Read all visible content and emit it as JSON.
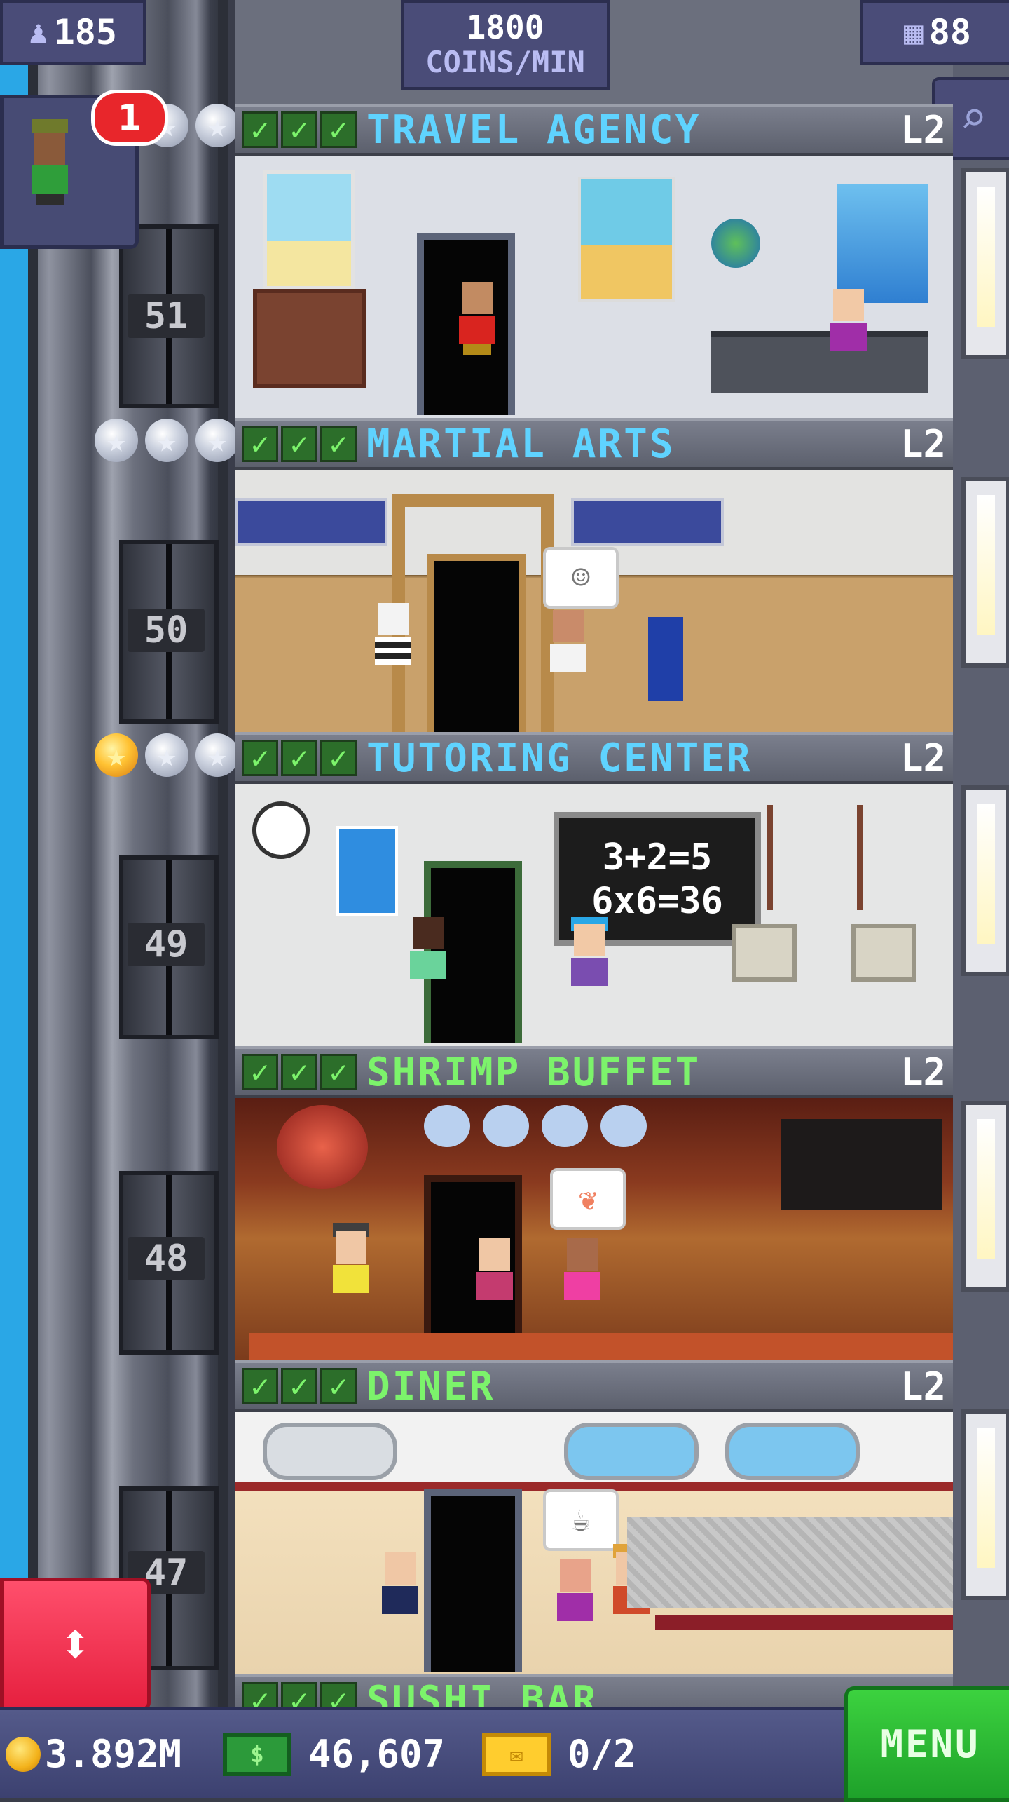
{
  "hud": {
    "population": "185",
    "coins_per_min_value": "1800",
    "coins_per_min_unit": "COINS/MIN",
    "floor_count": "88"
  },
  "notification": {
    "badge_count": "1"
  },
  "floors": [
    {
      "name": "TRAVEL AGENCY",
      "level": "L2",
      "name_color": "#5fd3ff"
    },
    {
      "name": "MARTIAL ARTS",
      "level": "L2",
      "name_color": "#5fd3ff"
    },
    {
      "name": "TUTORING CENTER",
      "level": "L2",
      "name_color": "#5fd3ff"
    },
    {
      "name": "SHRIMP BUFFET",
      "level": "L2",
      "name_color": "#7cf36b"
    },
    {
      "name": "DINER",
      "level": "L2",
      "name_color": "#7cf36b"
    },
    {
      "name": "SUSHI BAR",
      "level": "",
      "name_color": "#7cf36b"
    }
  ],
  "elevator_floor_numbers": [
    "51",
    "50",
    "49",
    "48",
    "47"
  ],
  "tutoring_board": {
    "line1": "3+2=5",
    "line2": "6x6=36"
  },
  "bottom_bar": {
    "coins": "3.892M",
    "bux": "46,607",
    "tickets": "0/2",
    "menu_label": "MENU"
  },
  "colors": {
    "menu_green": "#2bbf32",
    "elevator_red": "#f0344f",
    "hud_purple": "#4a4c78"
  }
}
